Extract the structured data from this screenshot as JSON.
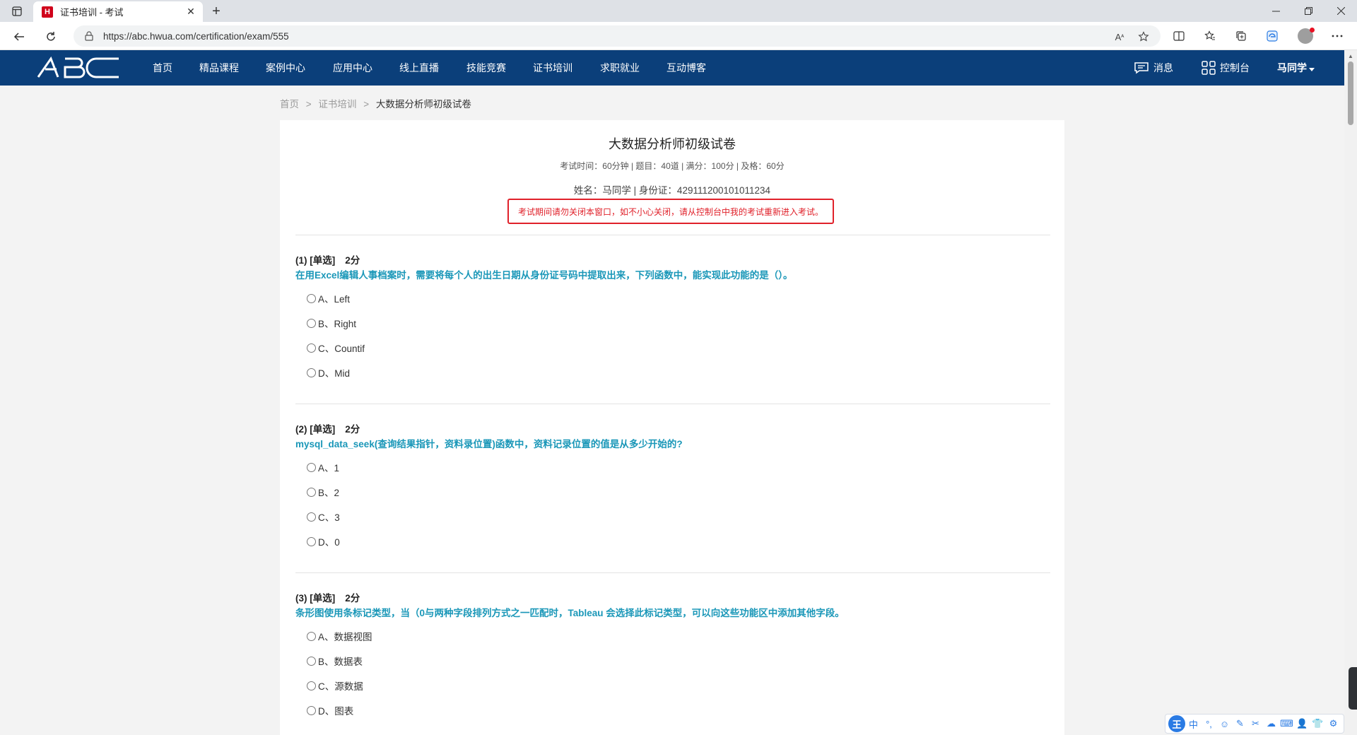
{
  "browser": {
    "tab_title": "证书培训 - 考试",
    "favicon_letter": "H",
    "url": "https://abc.hwua.com/certification/exam/555",
    "new_tab_symbol": "+",
    "close_symbol": "✕"
  },
  "site": {
    "logo_text": "ABC",
    "nav_items": [
      "首页",
      "精品课程",
      "案例中心",
      "应用中心",
      "线上直播",
      "技能竞赛",
      "证书培训",
      "求职就业",
      "互动博客"
    ],
    "messages_label": "消息",
    "console_label": "控制台",
    "user_label": "马同学"
  },
  "breadcrumb": {
    "home": "首页",
    "sep": ">",
    "section": "证书培训",
    "current": "大数据分析师初级试卷"
  },
  "exam": {
    "title": "大数据分析师初级试卷",
    "meta": "考试时间：60分钟 |   题目：40道 |   满分：100分 |   及格：60分",
    "user_info": "姓名：马同学 |   身份证：429111200101011234",
    "warning": "考试期间请勿关闭本窗口，如不小心关闭，请从控制台中我的考试重新进入考试。"
  },
  "questions": [
    {
      "head": "(1) [单选]",
      "points": "2分",
      "text": "在用Excel编辑人事档案时，需要将每个人的出生日期从身份证号码中提取出来，下列函数中，能实现此功能的是（）。",
      "options": [
        "A、Left",
        "B、Right",
        "C、Countif",
        "D、Mid"
      ]
    },
    {
      "head": "(2) [单选]",
      "points": "2分",
      "text": "mysql_data_seek(查询结果指针，资料录位置)函数中，资料记录位置的值是从多少开始的?",
      "options": [
        "A、1",
        "B、2",
        "C、3",
        "D、0"
      ]
    },
    {
      "head": "(3) [单选]",
      "points": "2分",
      "text": "条形图使用条标记类型，当（0与两种字段排列方式之一匹配时，Tableau 会选择此标记类型，可以向这些功能区中添加其他字段。",
      "options": [
        "A、数据视图",
        "B、数据表",
        "C、源数据",
        "D、图表"
      ]
    }
  ],
  "ime": {
    "logo": "王",
    "items": [
      "中",
      "°,",
      "☺",
      "✎",
      "✂",
      "☁",
      "⌨",
      "👤",
      "👕",
      "⚙"
    ]
  }
}
